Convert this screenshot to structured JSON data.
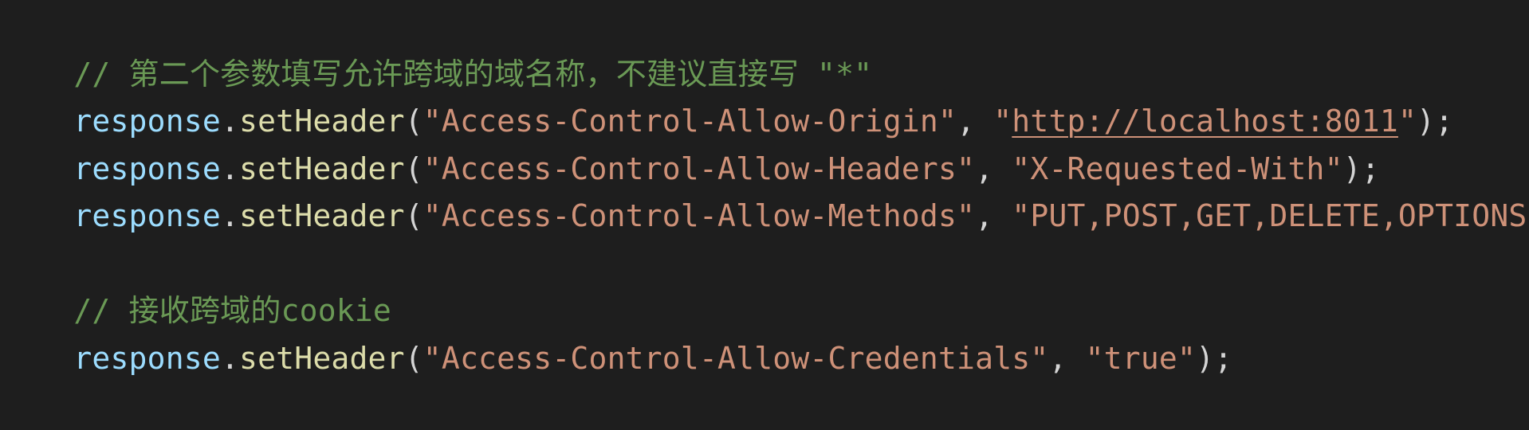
{
  "colors": {
    "background": "#1e1e1e",
    "comment": "#6a9955",
    "variable": "#9cdcfe",
    "function": "#dcdcaa",
    "string": "#ce9178",
    "punctuation": "#d4d4d4"
  },
  "code": {
    "line1": {
      "comment": "// 第二个参数填写允许跨域的域名称，不建议直接写 \"*\""
    },
    "line2": {
      "obj": "response",
      "dot": ".",
      "method": "setHeader",
      "open": "(",
      "arg1": "\"Access-Control-Allow-Origin\"",
      "comma": ", ",
      "q1": "\"",
      "url": "http://localhost:8011",
      "q2": "\"",
      "close": ");"
    },
    "line3": {
      "obj": "response",
      "dot": ".",
      "method": "setHeader",
      "open": "(",
      "arg1": "\"Access-Control-Allow-Headers\"",
      "comma": ", ",
      "arg2": "\"X-Requested-With\"",
      "close": ");"
    },
    "line4": {
      "obj": "response",
      "dot": ".",
      "method": "setHeader",
      "open": "(",
      "arg1": "\"Access-Control-Allow-Methods\"",
      "comma": ", ",
      "arg2": "\"PUT,POST,GET,DELETE,OPTIONS\"",
      "close": ");"
    },
    "line6": {
      "comment": "// 接收跨域的cookie"
    },
    "line7": {
      "obj": "response",
      "dot": ".",
      "method": "setHeader",
      "open": "(",
      "arg1": "\"Access-Control-Allow-Credentials\"",
      "comma": ", ",
      "arg2": "\"true\"",
      "close": ");"
    }
  }
}
